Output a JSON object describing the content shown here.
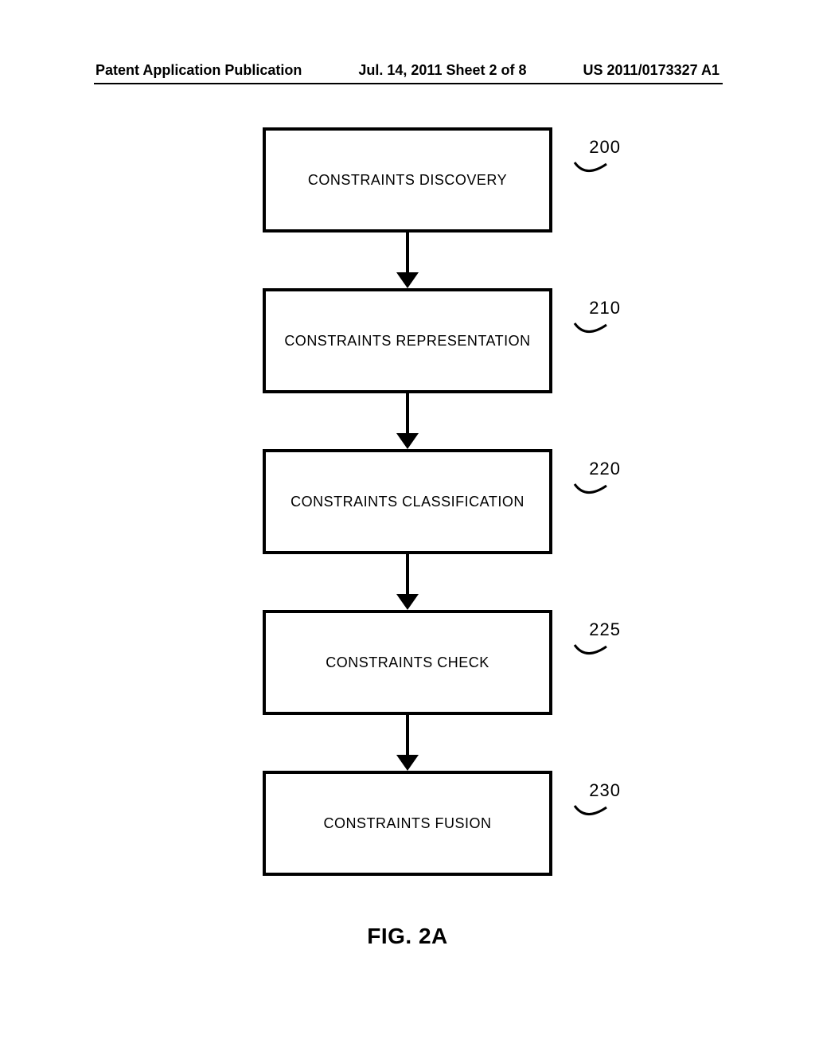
{
  "header": {
    "left": "Patent Application Publication",
    "center": "Jul. 14, 2011  Sheet 2 of 8",
    "right": "US 2011/0173327 A1"
  },
  "steps": [
    {
      "label": "CONSTRAINTS DISCOVERY",
      "ref": "200"
    },
    {
      "label": "CONSTRAINTS REPRESENTATION",
      "ref": "210"
    },
    {
      "label": "CONSTRAINTS CLASSIFICATION",
      "ref": "220"
    },
    {
      "label": "CONSTRAINTS CHECK",
      "ref": "225"
    },
    {
      "label": "CONSTRAINTS FUSION",
      "ref": "230"
    }
  ],
  "figure_label": "FIG. 2A"
}
